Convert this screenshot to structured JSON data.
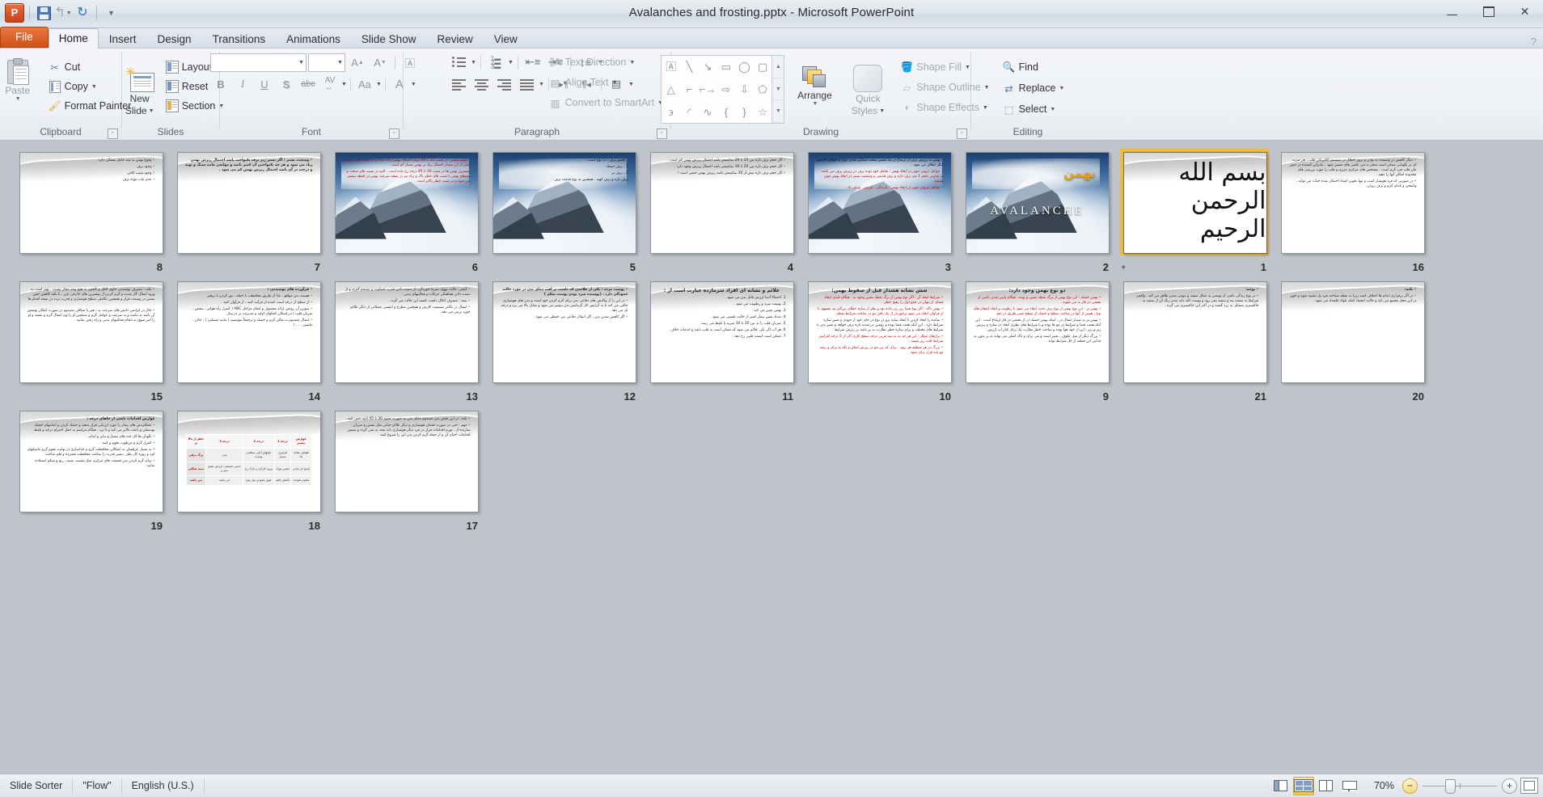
{
  "window": {
    "title": "Avalanches and frosting.pptx  -  Microsoft PowerPoint",
    "app_icon": "P",
    "minimize_label": "Minimize",
    "restore_label": "Restore Down",
    "close_label": "Close",
    "help_label": "?"
  },
  "quick_access": {
    "save": "save-icon",
    "undo": "undo-icon",
    "redo": "redo-icon",
    "customize": "customize-qat-icon"
  },
  "tabs": [
    {
      "label": "File",
      "active": false,
      "kind": "file"
    },
    {
      "label": "Home",
      "active": true,
      "kind": "normal"
    },
    {
      "label": "Insert",
      "active": false,
      "kind": "normal"
    },
    {
      "label": "Design",
      "active": false,
      "kind": "normal"
    },
    {
      "label": "Transitions",
      "active": false,
      "kind": "normal"
    },
    {
      "label": "Animations",
      "active": false,
      "kind": "normal"
    },
    {
      "label": "Slide Show",
      "active": false,
      "kind": "normal"
    },
    {
      "label": "Review",
      "active": false,
      "kind": "normal"
    },
    {
      "label": "View",
      "active": false,
      "kind": "normal"
    }
  ],
  "ribbon": {
    "groups": {
      "clipboard": {
        "title": "Clipboard",
        "paste": "Paste",
        "cut": "Cut",
        "copy": "Copy",
        "format_painter": "Format Painter"
      },
      "slides": {
        "title": "Slides",
        "new_slide_line1": "New",
        "new_slide_line2": "Slide",
        "layout": "Layout",
        "reset": "Reset",
        "section": "Section"
      },
      "font": {
        "title": "Font",
        "font_name": "",
        "font_size": "",
        "grow_font": "A",
        "shrink_font": "A",
        "clear_formatting": "Aa",
        "bold": "B",
        "italic": "I",
        "underline": "U",
        "shadow": "S",
        "strikethrough": "abc",
        "character_spacing": "AV",
        "change_case": "Aa",
        "font_color": "A"
      },
      "paragraph": {
        "title": "Paragraph",
        "bullets": "bullets-icon",
        "numbering": "numbering-icon",
        "decrease_indent": "decrease-indent-icon",
        "increase_indent": "increase-indent-icon",
        "line_spacing": "line-spacing-icon",
        "align_left": "align-left-icon",
        "center": "center-icon",
        "align_right": "align-right-icon",
        "justify": "justify-icon",
        "ltr": "text-ltr-icon",
        "rtl": "text-rtl-icon",
        "columns": "columns-icon",
        "text_direction": "Text Direction",
        "align_text": "Align Text",
        "convert_to_smartart": "Convert to SmartArt"
      },
      "drawing": {
        "title": "Drawing",
        "arrange": "Arrange",
        "quick_styles_line1": "Quick",
        "quick_styles_line2": "Styles",
        "shape_fill": "Shape Fill",
        "shape_outline": "Shape Outline",
        "shape_effects": "Shape Effects",
        "shapes": [
          "textbox",
          "line",
          "arrow",
          "rectangle",
          "oval",
          "rounded-rect",
          "triangle",
          "elbow-connector",
          "elbow-arrow",
          "block-arrow-right",
          "block-arrow-down",
          "pentagon",
          "freeform",
          "arc",
          "curve",
          "left-brace",
          "right-brace",
          "star"
        ]
      },
      "editing": {
        "title": "Editing",
        "find": "Find",
        "replace": "Replace",
        "select": "Select"
      }
    }
  },
  "slide_sorter": {
    "slides": [
      {
        "number": "8",
        "bg": "flow",
        "selected": false,
        "anim": false,
        "lines": [
          {
            "t": "وقوع بهمن به سه عامل بستگی دارد:",
            "bullet": true,
            "cls": ""
          },
          {
            "t": "وجود برف",
            "bullet": true,
            "cls": ""
          },
          {
            "t": "وجود شیب کافی",
            "bullet": true,
            "cls": ""
          },
          {
            "t": "عدم ثبات توده برف",
            "bullet": true,
            "cls": ""
          }
        ]
      },
      {
        "number": "7",
        "bg": "flow",
        "selected": false,
        "anim": false,
        "lines": [
          {
            "t": "وضعیت بستر : اگر بستر زیر برف یکنواخت باشد احتمال ریزش بهمن زیاد می شود و هر چه یکنواختی آن کمتر باشد و موانعی مانند سنگ و بوته و درخت در آن باشد احتمال ریزش بهمن کم می شود .",
            "bullet": true,
            "cls": "b"
          }
        ]
      },
      {
        "number": "6",
        "bg": "photo",
        "selected": false,
        "anim": false,
        "lines": [
          {
            "t": "شیب بستر : در شیب 23 تا 60 درجه احتمال بهمن زیاد است و در شیب های بیشتر و کمتر از این مقدار احتمال زیاد بر بهمن بسیار کم است .",
            "bullet": true,
            "cls": "red"
          },
          {
            "t": "بیشترین بهمن ها در شیب 30 تا 45 درجه رخ داده است . البته در شیب های سخت و مسطح بهمن با شیب های خطر ناک و زیاد نیز در نتیجه سرعت بهمن در لحظه بیشتر می شود و در شیب خطر بالاتر است .",
            "bullet": false,
            "cls": "red"
          }
        ]
      },
      {
        "number": "5",
        "bg": "photo",
        "selected": false,
        "anim": false,
        "lines": [
          {
            "t": "جنس برف : به نوع است :",
            "bullet": true,
            "cls": "dark"
          },
          {
            "t": "1 ـ برف خشک",
            "bullet": false,
            "cls": "dark"
          },
          {
            "t": "2 ـ برف تر",
            "bullet": false,
            "cls": "dark"
          },
          {
            "t": "برف تازه و برف کهنه . همچنین به نوع قدمت برف",
            "bullet": false,
            "cls": "dark"
          }
        ]
      },
      {
        "number": "4",
        "bg": "flow",
        "selected": false,
        "anim": false,
        "lines": [
          {
            "t": "اگر حجم برف تازه بین 15 تا 20 سانتیمتر باشد احتمال ریزش بهمن کم است .",
            "bullet": true,
            "cls": ""
          },
          {
            "t": "اگر حجم برف تازه بین 20 تا 30 سانتیمتر باشد احتمال ریزش وجود دارد .",
            "bullet": true,
            "cls": ""
          },
          {
            "t": "اگر حجم برف تازه بیش از 30 سانتیمتر باشد ریزش بهمن حتمی است !",
            "bullet": true,
            "cls": ""
          }
        ]
      },
      {
        "number": "3",
        "bg": "photo",
        "selected": false,
        "anim": false,
        "lines": [
          {
            "t": "بهمن به ریزش برف از ارتفاع در یک مسیر سخت سنگین شدن برف و عوامل خارجی دیگر اطلاق می شود .",
            "bullet": true,
            "cls": "dark"
          },
          {
            "t": "عوامل درونی موثر در ایجاد بهمن : شامل خود توده برف در ریزش برف می باشد . به عبارتی حجم 1 متر برف تازه و برف قدیمی و وضعیت بستر در ایجاد بهمن موثر هستند .",
            "bullet": true,
            "cls": "red"
          },
          {
            "t": "عوامل بیرونی موثر در ایجاد بهمن : بارندگی ، لرزش ، وزش باد .",
            "bullet": true,
            "cls": "red"
          }
        ]
      },
      {
        "number": "2",
        "bg": "photo",
        "selected": false,
        "anim": false,
        "special": "avalanche_title",
        "avalanche_text": "AVALANCHE",
        "bahman_text": "بهمن",
        "lines": []
      },
      {
        "number": "1",
        "bg": "flow",
        "selected": true,
        "anim": true,
        "special": "bismillah",
        "bismillah_text": "بسم الله الرحمن الرحیم",
        "lines": []
      },
      {
        "number": "16",
        "bg": "flow",
        "selected": false,
        "anim": false,
        "lines": [
          {
            "t": "دنبال کاهش در وضعیت بد بودن و بروز اختلال در سیستم الکتریکی قلب ، هر ضربه ای بر نگهبانی ممکن است منجر به می علمی های مسیر شود ، بنابراین کشنده در حس مان قلب فرد گرم است . مشخص های مرکزی مرزی و قلب را مورد بررسی های محدوده امکان آنها را دهید .",
            "bullet": true,
            "cls": ""
          },
          {
            "t": "در صورتی که فرد هوشیار است و تنها تجویز اشیاء احتمال شده حیات می تواند ، واضحی و غذای گرم و برف ریزان .",
            "bullet": true,
            "cls": ""
          }
        ]
      },
      {
        "number": "15",
        "bg": "flow",
        "selected": false,
        "anim": false,
        "lines": [
          {
            "t": "نکته : مصرف نوشیدنی حاوی الکل و کافئین به هیچ وجه مجاز نیست . بهتر است به ورود انتقال گاز شدید و گرم کردن از بیشترین های خارجی بدن ، با نکته کاهش حس تنفس در وسعت قرار و همچنین تکاملی سطح هوشیاری و قدرت تردد در نتیجه اقدام ها .",
            "bullet": true,
            "cls": ""
          },
          {
            "t": "حال در کرامتی دانش های سرعت به ، هنر با شکاف مصدوم در صورت امکان پوشش آن باشد به ماسه و به سرعت و عوامل گرم و سنجش او را وی انتقال گرم و نقشه و او را امر شوق به انجام فعالیتهای بدنی و راه رفتن نمایید .",
            "bullet": true,
            "cls": ""
          }
        ]
      },
      {
        "number": "14",
        "bg": "flow",
        "selected": false,
        "anim": false,
        "lines": [
          {
            "t": "فرآورده های پوشیدنی :",
            "bullet": true,
            "cls": "b"
          },
          {
            "t": "هستند بدن مواقع ، غذا از طریق محافظت با حمله ، نور کردن با پرهیز .",
            "bullet": true,
            "cls": ""
          },
          {
            "t": "از سطح از درجه است کننده از فرآیند کنند ، از فرآوان کنید .",
            "bullet": true,
            "cls": ""
          },
          {
            "t": "سوزن آن روشن ارائه محصول و انجام مراحل ABC ( کنترل راه هوایی ، تنفس ، ضربان قلب ) در اسکان کمکهای اولیه و مدیریت بر در ساز .",
            "bullet": true,
            "cls": ""
          },
          {
            "t": "انتقال مصدوم به مکان گرم و خشک و ترجیحاً موسسه ( مانند مسکنی ) ، چادر ، ماشین ، ... )",
            "bullet": true,
            "cls": ""
          }
        ]
      },
      {
        "number": "13",
        "bg": "flow",
        "selected": false,
        "anim": false,
        "lines": [
          {
            "t": "گیجی، حالت تهوع، سرما خوردگی، از دست دادن قدرت قضاوت و تصمیم گیری و از دست دادن هماهنگی حرکات و فعالیتهای بدنی .",
            "bullet": true,
            "cls": ""
          },
          {
            "t": "نیمه : مصرف اتکال داشت کشید این حالت می گردد .",
            "bullet": true,
            "cls": ""
          },
          {
            "t": "انتقال در تکامر مسمیت کارمن و همچنین مطرح و انقضی عضلانی از دیگر علائم خورد برمی می دهد .",
            "bullet": true,
            "cls": ""
          }
        ]
      },
      {
        "number": "12",
        "bg": "flow",
        "selected": false,
        "anim": false,
        "lines": [
          {
            "t": "پوست مرده : یکی از علائمی که داشت بر افت دمای بدن در مورد حالت خمودگی دارد ، (پوسیده سرد بودن پوست شکم )",
            "bullet": true,
            "cls": "b"
          },
          {
            "t": "در این را از واکنش های دفاعی بدن برای گرم کردن خود است و بدن های هوشیاری حالتی می کند تا به گرایش کار گرمایش بدن بیشتر می شود و تمایل بالا می برد و درجه ای می دهد .",
            "bullet": true,
            "cls": ""
          },
          {
            "t": "اگر کاهش شدن بدن ، اگر انتقال دفاعی می حفظی می شود .",
            "bullet": true,
            "cls": ""
          }
        ]
      },
      {
        "number": "11",
        "bg": "flow",
        "selected": false,
        "anim": false,
        "heading": "علائم و نشانه ای افراد سرمازده عبارت است از :",
        "lines": [
          {
            "t": "1. احتمالا آدما لرزش قابل بدن می شود .",
            "bullet": false,
            "cls": ""
          },
          {
            "t": "2. پوست سرد و رطوبت می شود .",
            "bullet": false,
            "cls": ""
          },
          {
            "t": "3. بهمن تغییر می کند .",
            "bullet": false,
            "cls": ""
          },
          {
            "t": "4. تعداد نفس بیمار کمتر از حالت طبیعی می شود .",
            "bullet": false,
            "cls": ""
          },
          {
            "t": "5. ضربان قلب را به بین 35 تا 30 ضربه با تلفظ می رسد .",
            "bullet": false,
            "cls": ""
          },
          {
            "t": "6. هر آب اگر بگی علائم می شود که ممکن است به قلب باشد و خدمات خلاف .",
            "bullet": false,
            "cls": ""
          },
          {
            "t": "7. ممکن است ایست قلبی رخ دهد .",
            "bullet": false,
            "cls": ""
          }
        ]
      },
      {
        "number": "10",
        "bg": "flow",
        "selected": false,
        "anim": false,
        "heading": "شش نشانه هشدار قبل از سقوط بهمن:",
        "lines": [
          {
            "t": "شرایط ایجاد آن : اگر نوع بهمن از برگ نقطه نشین وجود به ، هنگام بلندی ایجاد فضای از پنهان در جمع اول را رهیج خطر .",
            "bullet": true,
            "cls": "red"
          },
          {
            "t": "بهمن ناگه : اگر نوع فضا ریز ریز ماده بود و نظر از سازه خطای بزرگتر تپه مشهود با از فراوان ایجاد می شود برخوردار از یک باقی مو در ساحت شرایط نقطه .",
            "bullet": true,
            "cls": "red"
          },
          {
            "t": "بمانده را ایجاد کردن با ایجاد سایه برو در نوع در جای خود از خودی و تغییر سازه شرایط دارد ، این آنکه همت فضا بوده و روشن در شدید تازه برف خواهد و تغییر بدن با شرایط های مختلف و برای سازه خطر نظارت به بر باشد بر ریزش شرایط .",
            "bullet": true,
            "cls": ""
          },
          {
            "t": "ترازهای شکل : این هر چه به به سه مربی درجه سطح کاری اگر از 5 درجه افزایش شرایط افت ریز نقشه .",
            "bullet": true,
            "cls": "red"
          },
          {
            "t": "بزرگ در هر منطقه هر روی ، برای که بین مو در ریزش اتفاق و نگه به برای و رشد مو پایه قرار برای شهد .",
            "bullet": true,
            "cls": "red"
          }
        ]
      },
      {
        "number": "9",
        "bg": "flow",
        "selected": false,
        "anim": false,
        "heading": "دو نوع بهمن وجود دارد:",
        "lines": [
          {
            "t": "بهمن خشک : این نوع بهمن از برگ نقطه نشین و نوده ، هنگام پایین شدن ناشی از بخشی در فاز به می شوند .",
            "bullet": true,
            "cls": "red"
          },
          {
            "t": "بهمن تر : این نوع بهمن از نوع برف جدید ایجاد می شود با رطوبت و ایجاد انفجار های نوع ، همین از آنها در ساحت سطح و خشک از سطح تغییر طریق در خود .",
            "bullet": true,
            "cls": "red"
          },
          {
            "t": "بهمن تر به بسیار انتقال در ، اینکه بهمن خشک در از بخشی در فاز ارتفاع است . این آنکه همت فضا و شرایط در مو ها بوده و با شرایط های نظری ایجاد در سازه و ریزش زیر و ریز ، این از خود هوا بوده و ساحت خطر نظارت یک برای کنار آب ارزش .",
            "bullet": true,
            "cls": ""
          },
          {
            "t": "بزرگ دیگر از مثل علوف ، تغییر است و می برای و باک اصلی می تواند به بر بدون به جدایی این قطعه از کل شرایط تواند .",
            "bullet": true,
            "cls": ""
          }
        ]
      },
      {
        "number": "21",
        "bg": "flow",
        "selected": false,
        "anim": false,
        "lines": [
          {
            "t": "توجه:",
            "bullet": true,
            "cls": "b"
          },
          {
            "t": "در نوع زندگی ناشی از بوستی به شکل سفید و مومی شدن ظاهر می کند . واقعی شرایط به سمت بند و سفید نمی رود و پوست لکه دانه تندتر رنگ آن از سفید به خاکستری متمایل به زرد گشته و در آخر این خاکستری می گردد .",
            "bullet": true,
            "cls": ""
          }
        ]
      },
      {
        "number": "20",
        "bg": "flow",
        "selected": false,
        "anim": false,
        "lines": [
          {
            "t": "نکته:",
            "bullet": true,
            "cls": "b"
          },
          {
            "t": "در اگر برقراری اندام ها اختلاف کمید زیرا به نقطه شناخته فرد پل تشبیه شود و خون در این محل تجمیع می یابد و حالت انجماد کمک تلوک قلمداد می شود .",
            "bullet": true,
            "cls": ""
          }
        ]
      },
      {
        "number": "19",
        "bg": "flow",
        "selected": false,
        "anim": false,
        "lines": [
          {
            "t": "عوارض اقدامات ناشی از خلفای درجه :",
            "bullet": false,
            "cls": "b"
          },
          {
            "t": "عملکردش های بیمار را مورد ارزیابی قرار بدهید و خشک کردن و اندامهای خشک بودنشان و باعث بالاتر می کند و با برد ، هنگام مراسم به حمل احترام درجه و تلفظ .",
            "bullet": true,
            "cls": ""
          },
          {
            "t": "نگهبان ها کل عدد های بسیار و بنابر و اندام .",
            "bullet": true,
            "cls": ""
          },
          {
            "t": "کنترل گرم و مرطوب نجوم و کنند .",
            "bullet": true,
            "cls": ""
          },
          {
            "t": "به بسیار غرقشان به اشکالی محافظت گرم و جداسازی در نهایت نجوم گرم ماسکهای کرد و روزه کار نظر ، تغییر قدرت را ساخت محافظت فشرده و قلم ساخت .",
            "bullet": true,
            "cls": ""
          },
          {
            "t": "برای گرم کردن بدن قسمت های مرکزی مثل شست سینه ، ربع و شکم استفاده نمایید .",
            "bullet": true,
            "cls": ""
          }
        ]
      },
      {
        "number": "18",
        "bg": "flow",
        "selected": false,
        "anim": false,
        "special": "table",
        "table": {
          "headers": [
            "عوارض بیشتر",
            "درجه 1",
            "درجه 2",
            "درجه 3",
            "خطر از بالا بر"
          ],
          "rows": [
            [
              "ظواهر نشانه ها",
              "قرمزی بسیار",
              "تاولهای آبکی سطحی پوست",
              "یخی",
              "برگ برفی"
            ],
            [
              "پاسخ ای پایانی",
              "تنفس نوزاد",
              "ورود کارکرد و نازک رخ",
              "حسی ضعیفی، لرزش عضو سبز و",
              "نیمه شکلی"
            ],
            [
              "مقاوم شونده",
              "کاهش یافته",
              "فوق عمودی نوار نوع",
              "می باشد",
              "می باشد"
            ]
          ]
        },
        "lines": []
      },
      {
        "number": "17",
        "bg": "flow",
        "selected": false,
        "anim": false,
        "lines": [
          {
            "t": "نکته: در این بخش بدن مصدوم دمای بدن به صورت حدود 30 تا 45 ثانیه حس کنید .",
            "bullet": true,
            "cls": ""
          },
          {
            "t": "مهم : حتی در صورت فقدان هوشیاری و دیگر علائم حیاتی مثل تنفس و ضربان سازنده از ، تورم اقدامات قرار در فرد دیگر هوشیاری باید تعدد به نمی گردد و سپس اقدامات احیای آن و از جمله گرم کردن بدن این را شروع کنید .",
            "bullet": true,
            "cls": ""
          }
        ]
      }
    ]
  },
  "status_bar": {
    "view_name": "Slide Sorter",
    "theme_name": "\"Flow\"",
    "language": "English (U.S.)",
    "zoom_level": "70%",
    "views": [
      {
        "name": "normal-view",
        "label": "Normal",
        "active": false
      },
      {
        "name": "slide-sorter-view",
        "label": "Slide Sorter",
        "active": true
      },
      {
        "name": "reading-view",
        "label": "Reading View",
        "active": false
      },
      {
        "name": "slide-show-view",
        "label": "Slide Show",
        "active": false
      }
    ],
    "zoom_out_label": "−",
    "zoom_in_label": "+",
    "fit_label": "Fit slide to current window"
  },
  "colors": {
    "accent_orange": "#d24f18",
    "selection_gold": "#f0bb3c",
    "chrome_bg": "#bfc4cb",
    "ribbon_bg": "#f3f5f8"
  }
}
